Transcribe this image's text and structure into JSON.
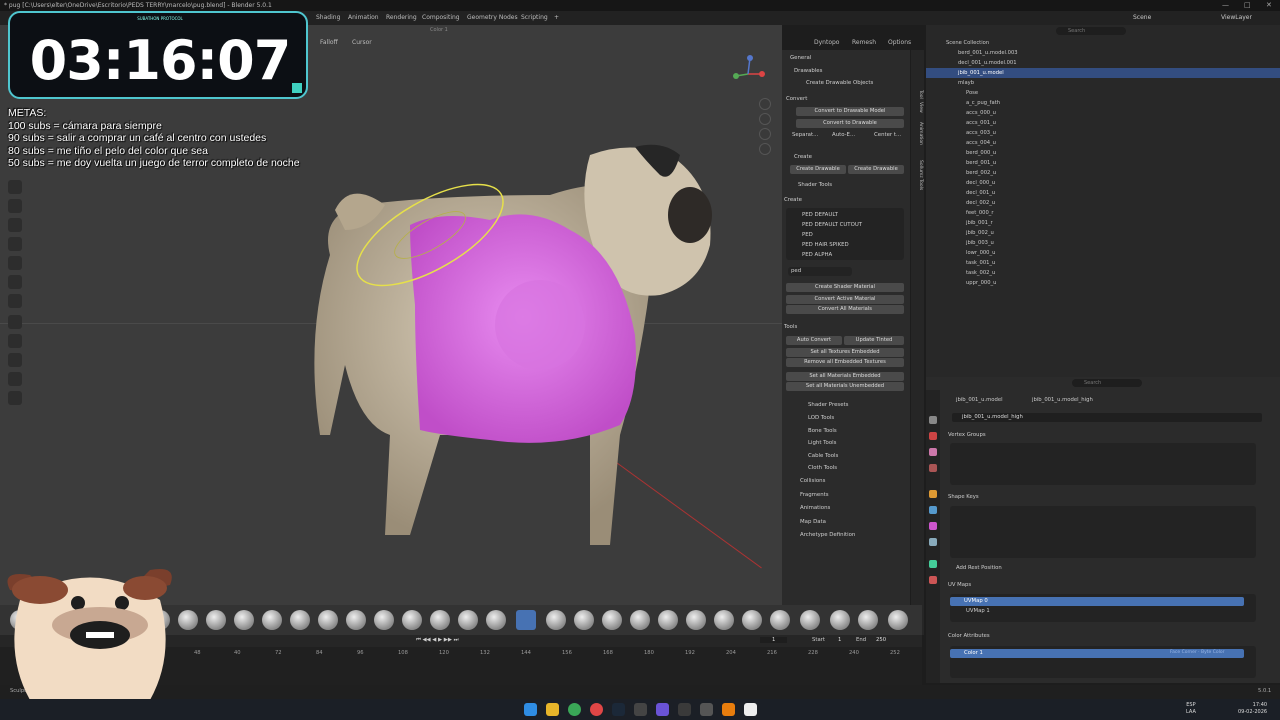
{
  "window": {
    "title": "* pug [C:\\Users\\elter\\OneDrive\\Escritorio\\PEDS TERRY\\marcelo\\pug.blend] - Blender 5.0.1"
  },
  "menubar": {
    "workspaces": [
      "Shading",
      "Animation",
      "Rendering",
      "Compositing",
      "Geometry Nodes",
      "Scripting",
      "+"
    ],
    "scene_label": "Scene",
    "viewlayer_label": "ViewLayer"
  },
  "viewport": {
    "falloff_label": "Falloff",
    "cursor_label": "Cursor",
    "dyntopo_label": "Dyntopo",
    "remesh_label": "Remesh",
    "options_label": "Options",
    "color_label": "Color 1"
  },
  "timer": {
    "value": "03:16:07",
    "subtitle": "SUBATHON PROTOCOL"
  },
  "metas": {
    "title": "METAS:",
    "lines": [
      "100 subs = cámara para siempre",
      "90 subs = salir a comprar un café al centro con ustedes",
      "80 subs = me tiño el pelo del color que sea",
      "50 subs = me doy vuelta un juego de terror completo de noche"
    ]
  },
  "npanel": {
    "tabs": [
      "Tool",
      "View",
      "Animation",
      "Sollumz Tools"
    ],
    "general": "General",
    "drawables": "Drawables",
    "create_drawable_objects": "Create Drawable Objects",
    "convert": "Convert",
    "convert_to_drawable_model": "Convert to Drawable Model",
    "convert_to_drawable": "Convert to Drawable",
    "separate": "Separat...",
    "auto_embed": "Auto-E...",
    "center": "Center t...",
    "create": "Create",
    "create_drawable_a": "Create Drawable",
    "create_drawable_b": "Create Drawable",
    "shader_tools": "Shader Tools",
    "create_label": "Create",
    "shaders": [
      "PED DEFAULT",
      "PED DEFAULT CUTOUT",
      "PED",
      "PED HAIR SPIKED",
      "PED ALPHA"
    ],
    "shader_filter": "ped",
    "create_shader_material": "Create Shader Material",
    "convert_active_material": "Convert Active Material",
    "convert_all_materials": "Convert All Materials",
    "tools_label": "Tools",
    "auto_convert": "Auto Convert",
    "update_tinted": "Update Tinted",
    "set_all_textures_embedded": "Set all Textures Embedded",
    "remove_all_embedded_textures": "Remove all Embedded Textures",
    "set_all_materials_embedded": "Set all Materials Embedded",
    "set_all_materials_unembedded": "Set all Materials Unembedded",
    "subpanels": [
      "Shader Presets",
      "LOD Tools",
      "Bone Tools",
      "Light Tools",
      "Cable Tools",
      "Cloth Tools"
    ],
    "sections": [
      "Collisions",
      "Fragments",
      "Animations",
      "Map Data",
      "Archetype Definition"
    ]
  },
  "outliner": {
    "search_placeholder": "Search",
    "scene_collection": "Scene Collection",
    "items": [
      "berd_001_u.model.003",
      "decl_001_u.model.001",
      "jbib_001_u.model",
      "mlayb",
      "Pose",
      "a_c_pug_fath",
      "accs_000_u",
      "accs_001_u",
      "accs_003_u",
      "accs_004_u",
      "berd_000_u",
      "berd_001_u",
      "berd_002_u",
      "decl_000_u",
      "decl_001_u",
      "decl_002_u",
      "feet_000_r",
      "jbib_001_r",
      "jbib_002_u",
      "jbib_003_u",
      "lowr_000_u",
      "task_001_u",
      "task_002_u",
      "uppr_000_u"
    ],
    "selected_index": 2
  },
  "properties": {
    "search_placeholder": "Search",
    "breadcrumb_a": "jbib_001_u.model",
    "breadcrumb_b": "jbib_001_u.model_high",
    "mesh_name": "jbib_001_u.model_high",
    "vertex_groups": "Vertex Groups",
    "shape_keys": "Shape Keys",
    "add_rest_position": "Add Rest Position",
    "uv_maps": "UV Maps",
    "uv_map_0": "UVMap 0",
    "uv_map_1": "UVMap 1",
    "color_attributes": "Color Attributes",
    "color_1": "Color 1",
    "color_1_info": "Face Corner · Byte Color"
  },
  "timeline": {
    "current_frame": "1",
    "start_label": "Start",
    "start_value": "1",
    "end_label": "End",
    "end_value": "250",
    "ticks": [
      "48",
      "40",
      "72",
      "84",
      "96",
      "108",
      "120",
      "132",
      "144",
      "156",
      "168",
      "180",
      "192",
      "204",
      "216",
      "228",
      "240",
      "252"
    ]
  },
  "statusbar": {
    "mode": "Sculpt",
    "version": "5.0.1"
  },
  "taskbar": {
    "lang": "ESP",
    "lang_sub": "LAA",
    "time": "17:40",
    "date": "09-02-2026"
  },
  "colors": {
    "accent": "#4772b3",
    "timer_border": "#4fc6cf",
    "mask_pink": "#e06ae6",
    "brush_ring": "#e6e04a"
  }
}
